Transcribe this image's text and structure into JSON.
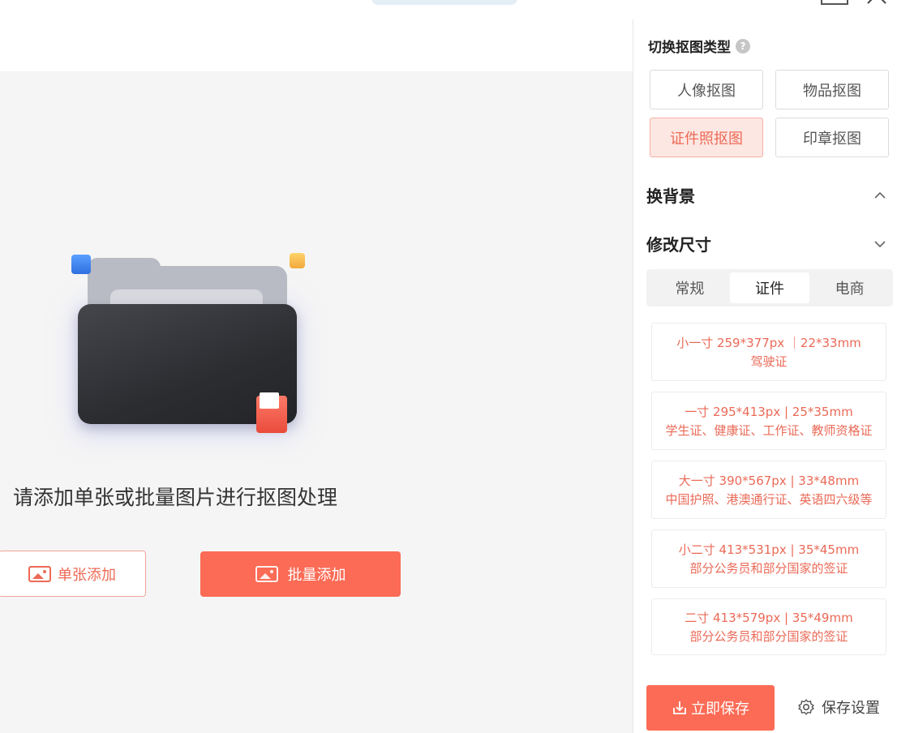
{
  "titlebar": {
    "menu_items": [
      "",
      "",
      ""
    ]
  },
  "workspace": {
    "hint": "请添加单张或批量图片进行抠图处理",
    "single_add_label": "单张添加",
    "batch_add_label": "批量添加"
  },
  "panel": {
    "type_section_title": "切换抠图类型",
    "type_options": [
      "人像抠图",
      "物品抠图",
      "证件照抠图",
      "印章抠图"
    ],
    "active_type": "证件照抠图",
    "change_background_label": "换背景",
    "resize_label": "修改尺寸",
    "size_tabs": [
      "常规",
      "证件",
      "电商"
    ],
    "active_size_tab": "证件",
    "size_presets": [
      {
        "spec": "小一寸 259*377px ｜22*33mm",
        "usage": "驾驶证"
      },
      {
        "spec": "一寸 295*413px | 25*35mm",
        "usage": "学生证、健康证、工作证、教师资格证"
      },
      {
        "spec": "大一寸 390*567px | 33*48mm",
        "usage": "中国护照、港澳通行证、英语四六级等"
      },
      {
        "spec": "小二寸 413*531px | 35*45mm",
        "usage": "部分公务员和部分国家的签证"
      },
      {
        "spec": "二寸 413*579px | 35*49mm",
        "usage": "部分公务员和部分国家的签证"
      }
    ],
    "save_now_label": "立即保存",
    "save_settings_label": "保存设置"
  },
  "colors": {
    "accent": "#fb6b55",
    "accent_text": "#ea6a57",
    "active_bg": "#fde7e3"
  }
}
